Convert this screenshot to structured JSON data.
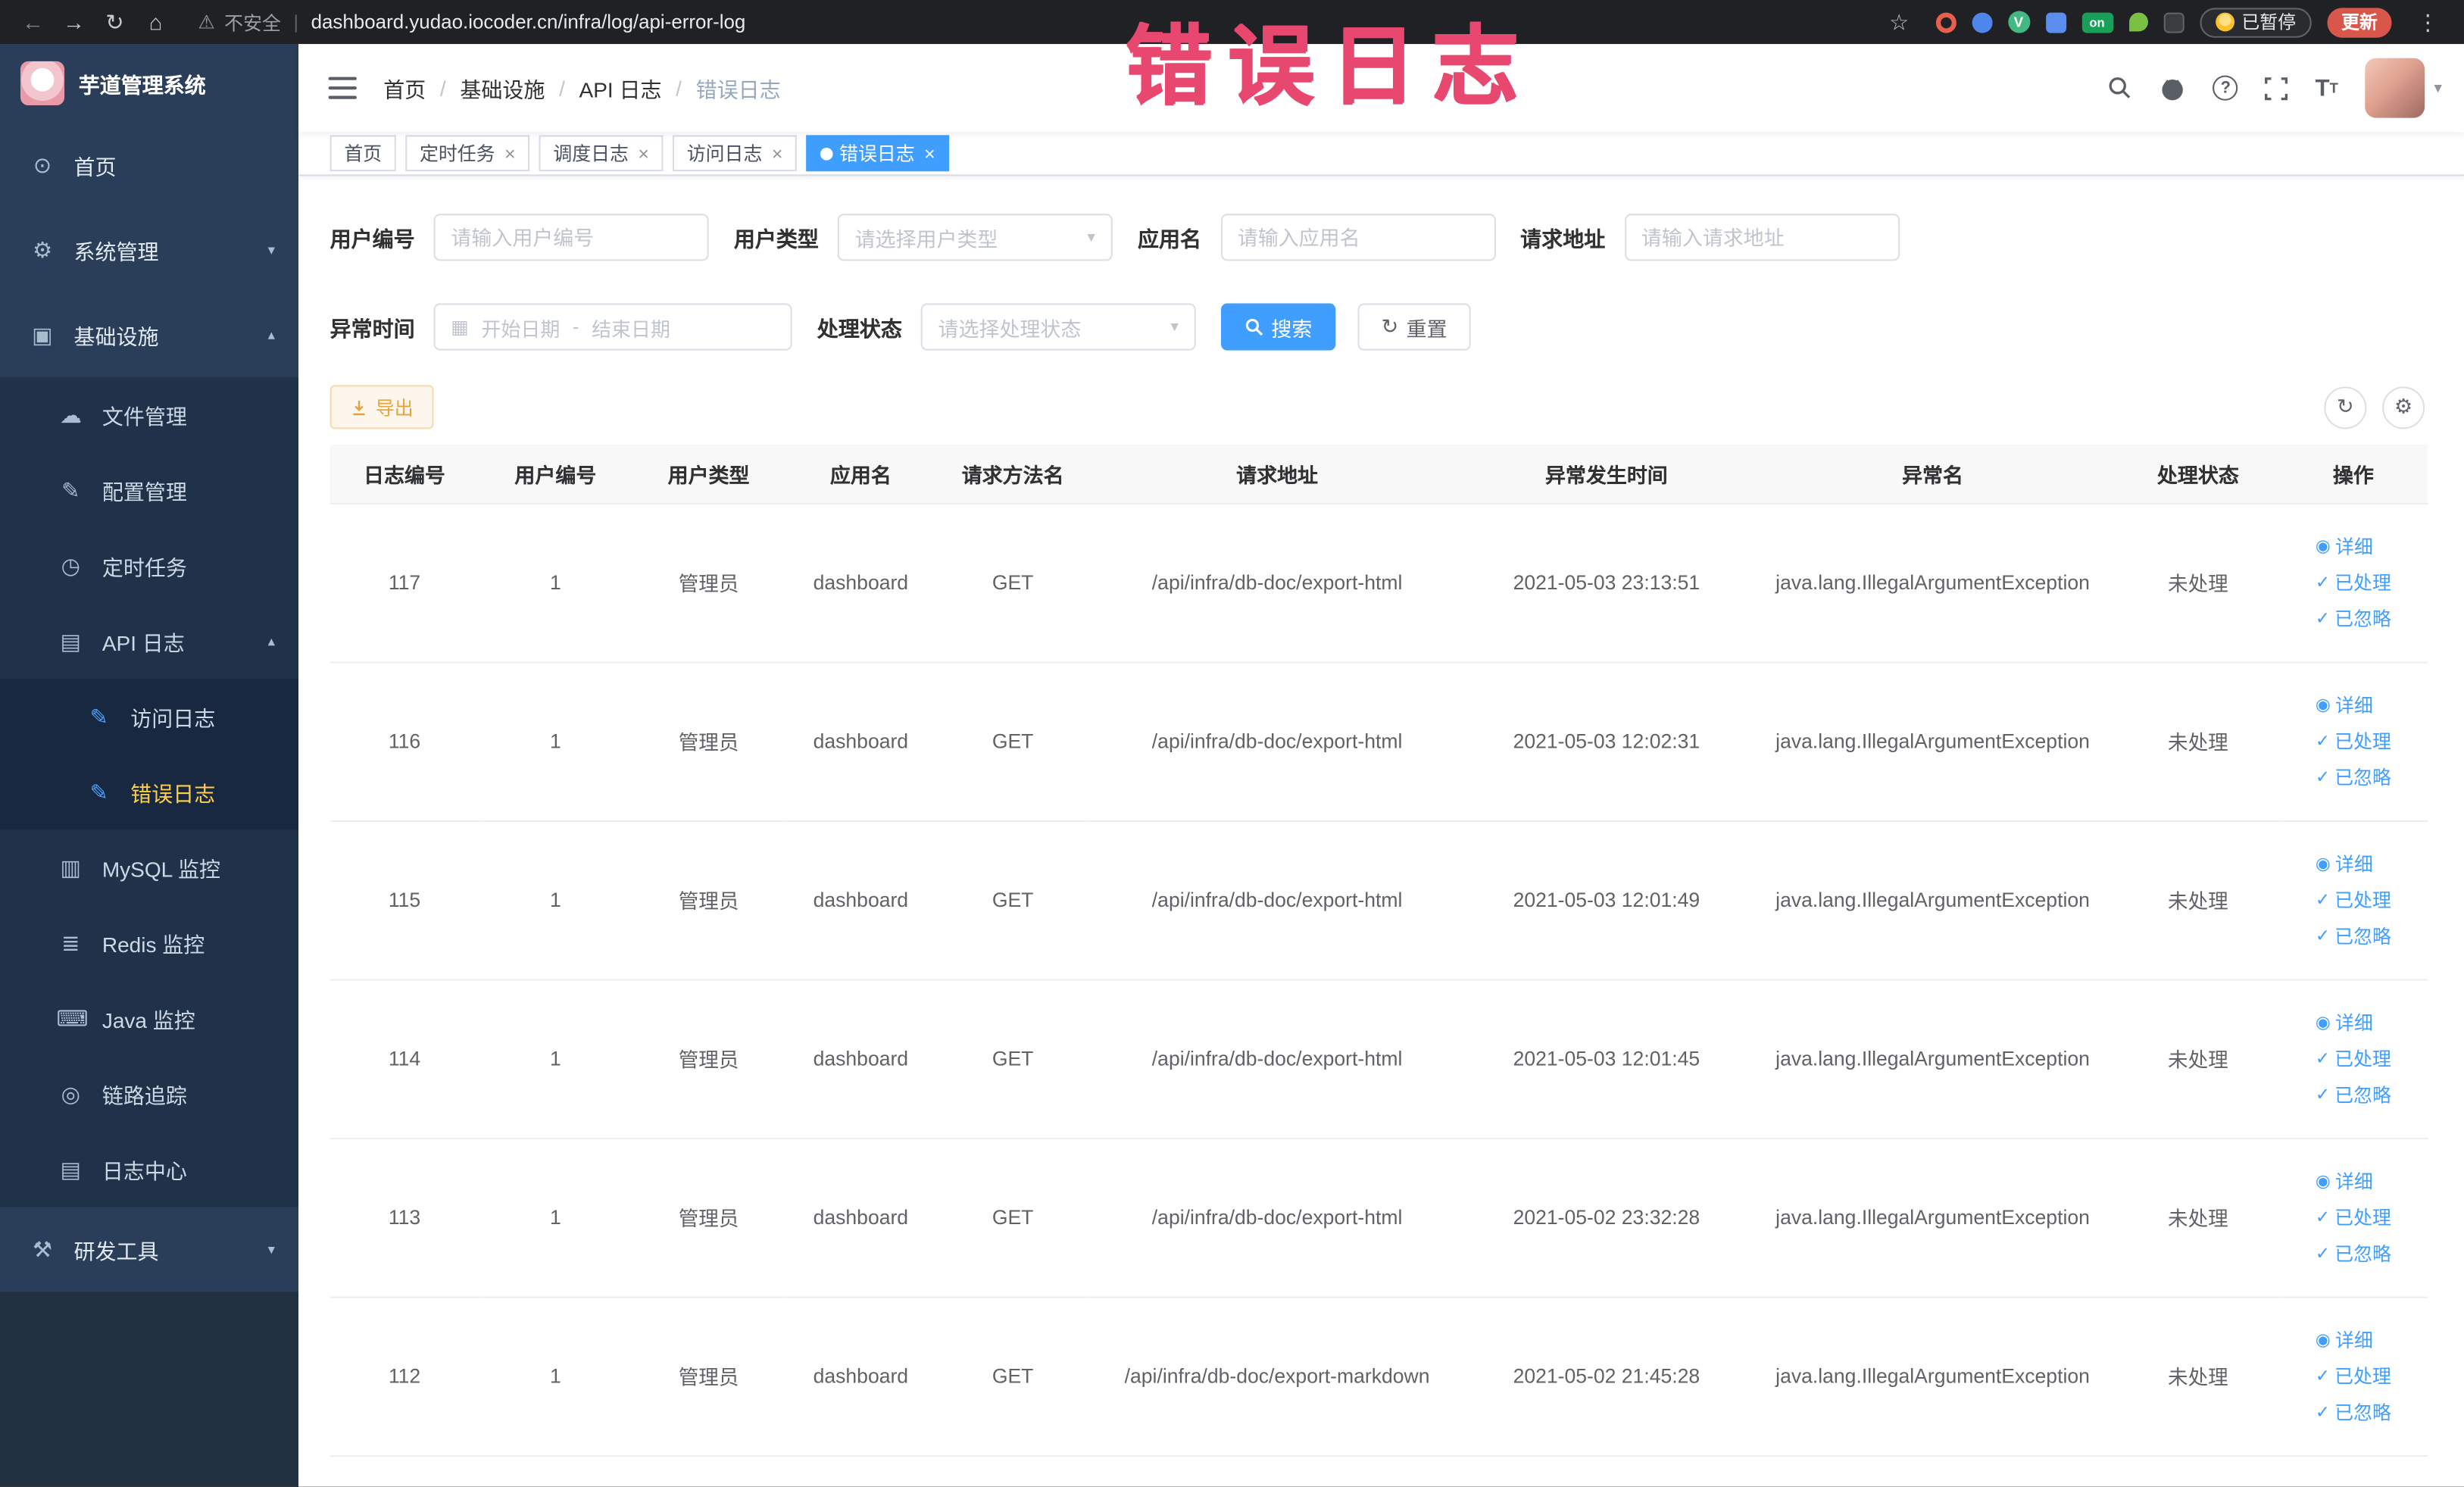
{
  "colors": {
    "accent": "#409eff",
    "tab_active_bg": "#409eff",
    "warning": "#e6a23c",
    "annotation": "#e8486f",
    "sidebar_active": "#ffd04b"
  },
  "browser": {
    "security_label": "不安全",
    "url_separator": "|",
    "url": "dashboard.yudao.iocoder.cn/infra/log/api-error-log",
    "extension_badge": "on",
    "paused_badge": "已暂停",
    "update_button": "更新"
  },
  "annotation": "错误日志",
  "sidebar": {
    "logo_title": "芋道管理系统",
    "menu": [
      {
        "key": "home",
        "label": "首页",
        "icon": "dashboard-icon",
        "level": 1
      },
      {
        "key": "system-management",
        "label": "系统管理",
        "icon": "gear-icon",
        "level": 1,
        "arrow": "down"
      },
      {
        "key": "infrastructure",
        "label": "基础设施",
        "icon": "infra-icon",
        "level": 1,
        "arrow": "up"
      },
      {
        "key": "file-management",
        "label": "文件管理",
        "icon": "cloud-icon",
        "level": 2
      },
      {
        "key": "config-management",
        "label": "配置管理",
        "icon": "edit-square-icon",
        "level": 2
      },
      {
        "key": "cron-jobs",
        "label": "定时任务",
        "icon": "timer-icon",
        "level": 2
      },
      {
        "key": "api-log",
        "label": "API 日志",
        "icon": "document-icon",
        "level": 2,
        "arrow": "up"
      },
      {
        "key": "access-log",
        "label": "访问日志",
        "icon": "pencil-icon",
        "level": 3
      },
      {
        "key": "error-log",
        "label": "错误日志",
        "icon": "pencil-icon",
        "level": 3,
        "active": true
      },
      {
        "key": "mysql-monitor",
        "label": "MySQL 监控",
        "icon": "database-icon",
        "level": 2
      },
      {
        "key": "redis-monitor",
        "label": "Redis 监控",
        "icon": "layers-icon",
        "level": 2
      },
      {
        "key": "java-monitor",
        "label": "Java 监控",
        "icon": "monitor-icon",
        "level": 2
      },
      {
        "key": "tracing",
        "label": "链路追踪",
        "icon": "eye-icon",
        "level": 2
      },
      {
        "key": "log-center",
        "label": "日志中心",
        "icon": "log-icon",
        "level": 2
      },
      {
        "key": "dev-tools",
        "label": "研发工具",
        "icon": "tools-icon",
        "level": 1,
        "arrow": "down"
      }
    ]
  },
  "breadcrumb": {
    "separator": "/",
    "items": [
      "首页",
      "基础设施",
      "API 日志",
      "错误日志"
    ]
  },
  "tabs": {
    "items": [
      {
        "label": "首页",
        "closable": false,
        "active": false
      },
      {
        "label": "定时任务",
        "closable": true,
        "active": false
      },
      {
        "label": "调度日志",
        "closable": true,
        "active": false
      },
      {
        "label": "访问日志",
        "closable": true,
        "active": false
      },
      {
        "label": "错误日志",
        "closable": true,
        "active": true
      }
    ]
  },
  "filters": {
    "user_id": {
      "label": "用户编号",
      "placeholder": "请输入用户编号"
    },
    "user_type": {
      "label": "用户类型",
      "placeholder": "请选择用户类型"
    },
    "app_name": {
      "label": "应用名",
      "placeholder": "请输入应用名"
    },
    "request_url": {
      "label": "请求地址",
      "placeholder": "请输入请求地址"
    },
    "exception_time": {
      "label": "异常时间",
      "start_placeholder": "开始日期",
      "separator": "-",
      "end_placeholder": "结束日期"
    },
    "process_status": {
      "label": "处理状态",
      "placeholder": "请选择处理状态"
    },
    "search_label": "搜索",
    "reset_label": "重置"
  },
  "toolbar": {
    "export_label": "导出"
  },
  "table": {
    "columns": [
      "日志编号",
      "用户编号",
      "用户类型",
      "应用名",
      "请求方法名",
      "请求地址",
      "异常发生时间",
      "异常名",
      "处理状态",
      "操作"
    ],
    "row_actions": {
      "detail": "详细",
      "processed": "已处理",
      "ignored": "已忽略"
    },
    "rows": [
      {
        "id": "117",
        "user_id": "1",
        "user_type": "管理员",
        "app": "dashboard",
        "method": "GET",
        "url": "/api/infra/db-doc/export-html",
        "time": "2021-05-03 23:13:51",
        "exception": "java.lang.IllegalArgumentException",
        "status": "未处理"
      },
      {
        "id": "116",
        "user_id": "1",
        "user_type": "管理员",
        "app": "dashboard",
        "method": "GET",
        "url": "/api/infra/db-doc/export-html",
        "time": "2021-05-03 12:02:31",
        "exception": "java.lang.IllegalArgumentException",
        "status": "未处理"
      },
      {
        "id": "115",
        "user_id": "1",
        "user_type": "管理员",
        "app": "dashboard",
        "method": "GET",
        "url": "/api/infra/db-doc/export-html",
        "time": "2021-05-03 12:01:49",
        "exception": "java.lang.IllegalArgumentException",
        "status": "未处理"
      },
      {
        "id": "114",
        "user_id": "1",
        "user_type": "管理员",
        "app": "dashboard",
        "method": "GET",
        "url": "/api/infra/db-doc/export-html",
        "time": "2021-05-03 12:01:45",
        "exception": "java.lang.IllegalArgumentException",
        "status": "未处理"
      },
      {
        "id": "113",
        "user_id": "1",
        "user_type": "管理员",
        "app": "dashboard",
        "method": "GET",
        "url": "/api/infra/db-doc/export-html",
        "time": "2021-05-02 23:32:28",
        "exception": "java.lang.IllegalArgumentException",
        "status": "未处理"
      },
      {
        "id": "112",
        "user_id": "1",
        "user_type": "管理员",
        "app": "dashboard",
        "method": "GET",
        "url": "/api/infra/db-doc/export-markdown",
        "time": "2021-05-02 21:45:28",
        "exception": "java.lang.IllegalArgumentException",
        "status": "未处理"
      }
    ]
  }
}
